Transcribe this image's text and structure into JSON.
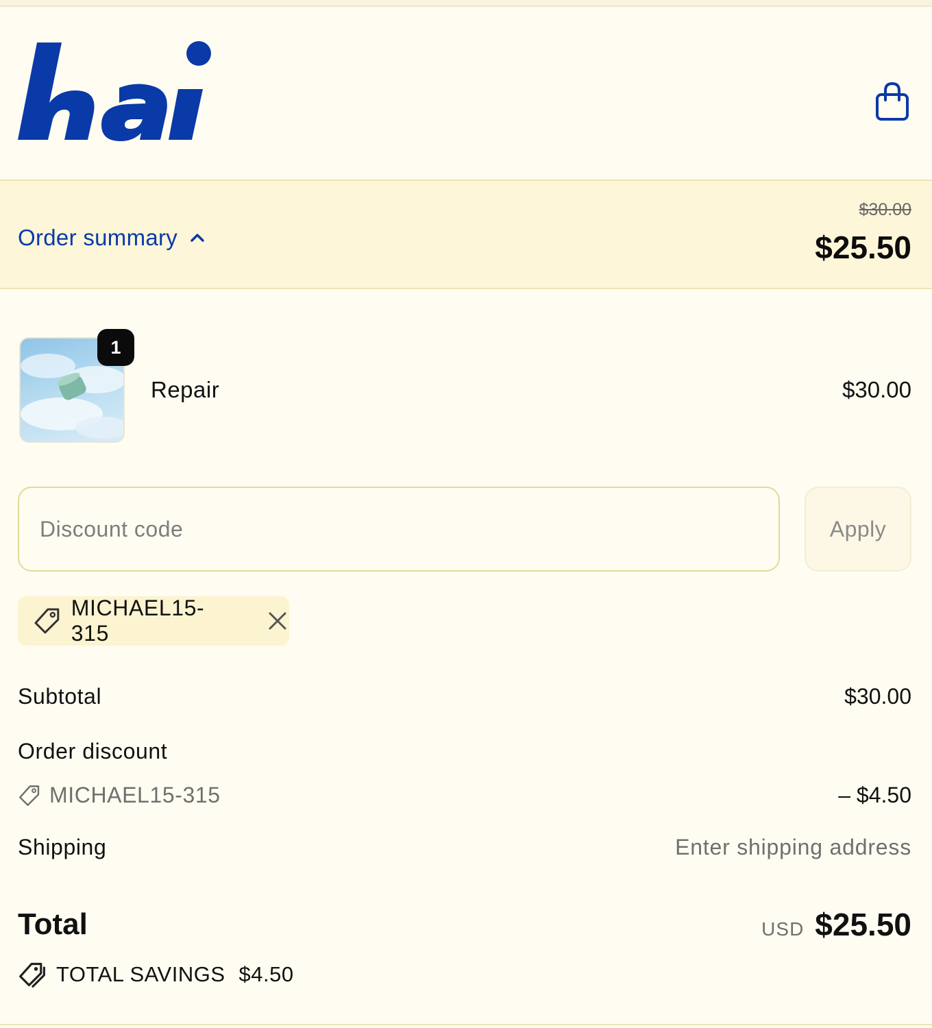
{
  "brand": {
    "logo_text": "hai",
    "color": "#0a3aa8"
  },
  "header": {
    "cart_icon": "shopping-bag-icon"
  },
  "summary": {
    "toggle_label": "Order summary",
    "toggle_icon": "chevron-up-icon",
    "original_price": "$30.00",
    "total": "$25.50"
  },
  "line_item": {
    "quantity": "1",
    "name": "Repair",
    "price": "$30.00"
  },
  "discount": {
    "placeholder": "Discount code",
    "value": "",
    "apply_label": "Apply",
    "applied_code": "MICHAEL15-315"
  },
  "totals": {
    "subtotal_label": "Subtotal",
    "subtotal_value": "$30.00",
    "order_discount_label": "Order discount",
    "discount_code": "MICHAEL15-315",
    "discount_value": "– $4.50",
    "shipping_label": "Shipping",
    "shipping_value": "Enter shipping address",
    "total_label": "Total",
    "currency": "USD",
    "total_value": "$25.50",
    "savings_label": "TOTAL SAVINGS",
    "savings_value": "$4.50"
  },
  "colors": {
    "background": "#fffdf1",
    "summary_bar": "#fdf6d9",
    "accent": "#0a3aa8",
    "chip": "#fcf3d0"
  }
}
